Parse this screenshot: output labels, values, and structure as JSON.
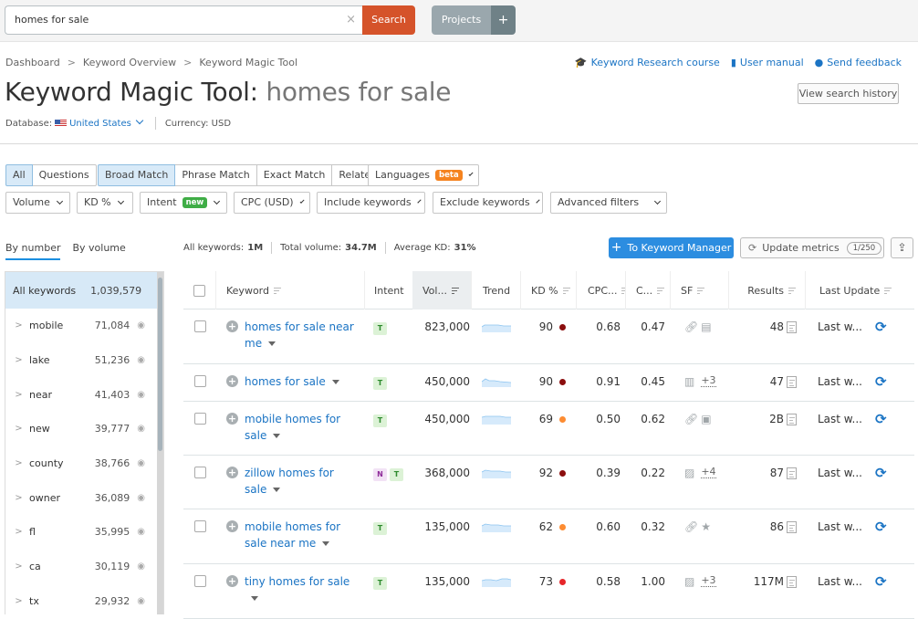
{
  "search": {
    "value": "homes for sale",
    "clear_icon": "×",
    "button": "Search"
  },
  "projects": {
    "label": "Projects",
    "plus": "+"
  },
  "breadcrumb": [
    "Dashboard",
    "Keyword Overview",
    "Keyword Magic Tool"
  ],
  "breadcrumb_sep": ">",
  "title": {
    "tool": "Keyword Magic Tool:",
    "query": "homes for sale"
  },
  "database": {
    "label": "Database:",
    "country": "United States",
    "currency": "Currency: USD"
  },
  "top_links": [
    {
      "icon": "graduation-cap-icon",
      "label": "Keyword Research course"
    },
    {
      "icon": "book-icon",
      "label": "User manual"
    },
    {
      "icon": "chat-bubble-icon",
      "label": "Send feedback"
    }
  ],
  "history_button": "View search history",
  "filters_row1": {
    "group1": [
      "All",
      "Questions"
    ],
    "group2": [
      "Broad Match",
      "Phrase Match",
      "Exact Match",
      "Related"
    ],
    "languages": {
      "label": "Languages",
      "badge": "beta"
    }
  },
  "filters_row2": [
    {
      "label": "Volume"
    },
    {
      "label": "KD %"
    },
    {
      "label": "Intent",
      "badge": "new"
    },
    {
      "label": "CPC (USD)"
    },
    {
      "label": "Include keywords"
    },
    {
      "label": "Exclude keywords"
    },
    {
      "label": "Advanced filters"
    }
  ],
  "colors": {
    "accent": "#2c8de0",
    "search": "#d5532a",
    "beta": "#f5831f",
    "new": "#3fad46",
    "link": "#1b74c4"
  },
  "group_tabs": [
    "By number",
    "By volume"
  ],
  "stats": {
    "all_label": "All keywords:",
    "all_value": "1M",
    "vol_label": "Total volume:",
    "vol_value": "34.7M",
    "kd_label": "Average KD:",
    "kd_value": "31%"
  },
  "actions": {
    "keyword_manager": "To Keyword Manager",
    "update_metrics": "Update metrics",
    "update_count": "1/250",
    "export_icon": "export-icon"
  },
  "sidebar": {
    "all": {
      "label": "All keywords",
      "count": "1,039,579"
    },
    "groups": [
      {
        "label": "mobile",
        "count": "71,084"
      },
      {
        "label": "lake",
        "count": "51,236"
      },
      {
        "label": "near",
        "count": "41,403"
      },
      {
        "label": "new",
        "count": "39,777"
      },
      {
        "label": "county",
        "count": "38,766"
      },
      {
        "label": "owner",
        "count": "36,089"
      },
      {
        "label": "fl",
        "count": "35,995"
      },
      {
        "label": "ca",
        "count": "30,119"
      },
      {
        "label": "tx",
        "count": "29,932"
      }
    ]
  },
  "table": {
    "headers": {
      "keyword": "Keyword",
      "intent": "Intent",
      "volume": "Vol...",
      "trend": "Trend",
      "kd": "KD %",
      "cpc": "CPC...",
      "com": "C...",
      "sf": "SF",
      "results": "Results",
      "last_update": "Last Update"
    },
    "rows": [
      {
        "keyword": "homes for sale near me",
        "intent": [
          "T"
        ],
        "volume": "823,000",
        "kd": "90",
        "kd_color": "#8b0e0e",
        "cpc": "0.68",
        "com": "0.47",
        "sf": [
          "link-icon",
          "ad-icon"
        ],
        "sf_more": "",
        "results": "48",
        "last_update": "Last w..."
      },
      {
        "keyword": "homes for sale",
        "intent": [
          "T"
        ],
        "volume": "450,000",
        "kd": "90",
        "kd_color": "#8b0e0e",
        "cpc": "0.91",
        "com": "0.45",
        "sf": [
          "local-pack-icon"
        ],
        "sf_more": "+3",
        "results": "47",
        "last_update": "Last w..."
      },
      {
        "keyword": "mobile homes for sale",
        "intent": [
          "T"
        ],
        "volume": "450,000",
        "kd": "69",
        "kd_color": "#fd8c32",
        "cpc": "0.50",
        "com": "0.62",
        "sf": [
          "link-icon",
          "faq-icon"
        ],
        "sf_more": "",
        "results": "2B",
        "last_update": "Last w..."
      },
      {
        "keyword": "zillow homes for sale",
        "intent": [
          "N",
          "T"
        ],
        "volume": "368,000",
        "kd": "92",
        "kd_color": "#8b0e0e",
        "cpc": "0.39",
        "com": "0.22",
        "sf": [
          "image-icon"
        ],
        "sf_more": "+4",
        "results": "87",
        "last_update": "Last w..."
      },
      {
        "keyword": "mobile homes for sale near me",
        "intent": [
          "T"
        ],
        "volume": "135,000",
        "kd": "62",
        "kd_color": "#fd8c32",
        "cpc": "0.60",
        "com": "0.32",
        "sf": [
          "link-icon",
          "star-icon"
        ],
        "sf_more": "",
        "results": "86",
        "last_update": "Last w..."
      },
      {
        "keyword": "tiny homes for sale",
        "intent": [
          "T"
        ],
        "volume": "135,000",
        "kd": "73",
        "kd_color": "#e6262a",
        "cpc": "0.58",
        "com": "1.00",
        "sf": [
          "image-icon"
        ],
        "sf_more": "+3",
        "results": "117M",
        "last_update": "Last w..."
      }
    ]
  }
}
